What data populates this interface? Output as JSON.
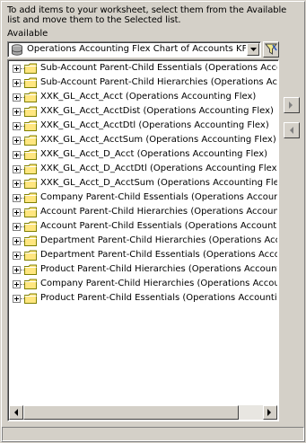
{
  "instructions": "To add items to your worksheet, select them from the Available list and move them to the Selected list.",
  "available_label": "Available",
  "business_area": {
    "selected": "Operations Accounting Flex Chart of Accounts KFF Views - N"
  },
  "tree_items": [
    {
      "label": "Sub-Account Parent-Child Essentials (Operations Accounting Flex)"
    },
    {
      "label": "Sub-Account Parent-Child Hierarchies (Operations Accounting Flex)"
    },
    {
      "label": "XXK_GL_Acct_Acct (Operations Accounting Flex)"
    },
    {
      "label": "XXK_GL_Acct_AcctDist (Operations Accounting Flex)"
    },
    {
      "label": "XXK_GL_Acct_AcctDtl (Operations Accounting Flex)"
    },
    {
      "label": "XXK_GL_Acct_AcctSum (Operations Accounting Flex)"
    },
    {
      "label": "XXK_GL_Acct_D_Acct (Operations Accounting Flex)"
    },
    {
      "label": "XXK_GL_Acct_D_AcctDtl (Operations Accounting Flex)"
    },
    {
      "label": "XXK_GL_Acct_D_AcctSum (Operations Accounting Flex)"
    },
    {
      "label": "Company Parent-Child Essentials (Operations Accounting Flex)"
    },
    {
      "label": "Account Parent-Child Hierarchies (Operations Accounting Flex)"
    },
    {
      "label": "Account Parent-Child Essentials (Operations Accounting Flex)"
    },
    {
      "label": "Department Parent-Child Hierarchies (Operations Accounting Flex)"
    },
    {
      "label": "Department Parent-Child Essentials (Operations Accounting Flex)"
    },
    {
      "label": "Product Parent-Child Hierarchies (Operations Accounting Flex)"
    },
    {
      "label": "Company Parent-Child Hierarchies (Operations Accounting Flex)"
    },
    {
      "label": "Product Parent-Child Essentials (Operations Accounting Flex)"
    }
  ],
  "colors": {
    "window_bg": "#d4d0c8",
    "folder_fill": "#ffe680",
    "folder_stroke": "#808000"
  }
}
